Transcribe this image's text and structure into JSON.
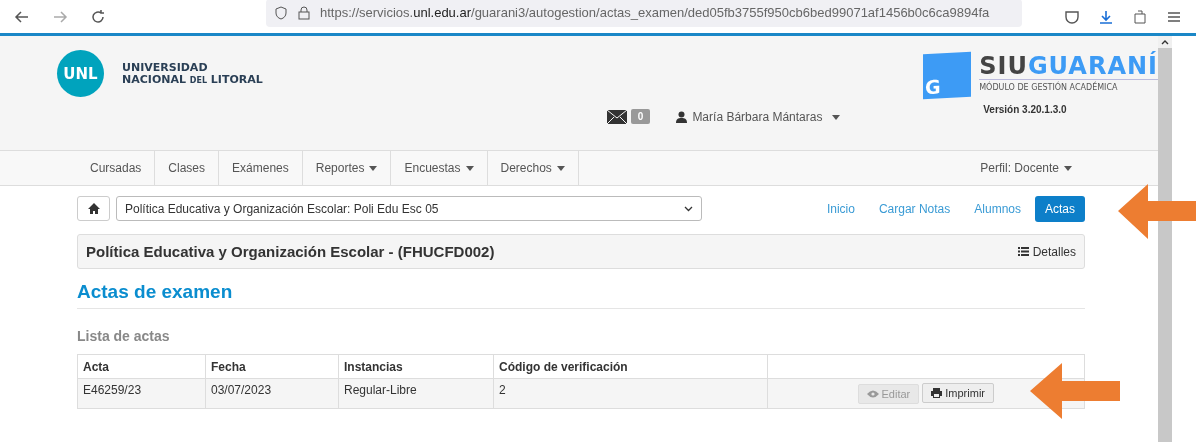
{
  "browser": {
    "url_host_before": "https://servicios.",
    "url_host": "unl.edu.ar",
    "url_path": "/guarani3/autogestion/actas_examen/ded05fb3755f950cb6bed99071af1456b0c6ca9894fa"
  },
  "header": {
    "unl_logo": {
      "mark": "UNL",
      "line1": "UNIVERSIDAD",
      "line2_start": "NACIONAL",
      "line2_small": "DEL",
      "line2_end": "LITORAL"
    },
    "messages_count": "0",
    "user": "María Bárbara Mántaras",
    "siu_logo": {
      "mark": "G",
      "siu": "SIU",
      "guarani": "GUARANÍ",
      "subtitle": "MÓDULO DE GESTIÓN ACADÉMICA"
    },
    "version": "Versión 3.20.1.3.0"
  },
  "nav": {
    "items": [
      {
        "label": "Cursadas",
        "dropdown": false
      },
      {
        "label": "Clases",
        "dropdown": false
      },
      {
        "label": "Exámenes",
        "dropdown": false
      },
      {
        "label": "Reportes",
        "dropdown": true
      },
      {
        "label": "Encuestas",
        "dropdown": true
      },
      {
        "label": "Derechos",
        "dropdown": true
      }
    ],
    "profile": "Perfil: Docente"
  },
  "course_select": {
    "value": "Política Educativa y Organización Escolar: Poli Edu Esc 05"
  },
  "subnav": [
    {
      "label": "Inicio",
      "selected": false
    },
    {
      "label": "Cargar Notas",
      "selected": false
    },
    {
      "label": "Alumnos",
      "selected": false
    },
    {
      "label": "Actas",
      "selected": true
    }
  ],
  "panel": {
    "title": "Política Educativa y Organización Escolar - (FHUCFD002)",
    "details": "Detalles"
  },
  "heading": "Actas de examen",
  "subheading": "Lista de actas",
  "table": {
    "columns": [
      "Acta",
      "Fecha",
      "Instancias",
      "Código de verificación"
    ],
    "rows": [
      {
        "cells": [
          "E46259/23",
          "03/07/2023",
          "Regular-Libre",
          "2"
        ],
        "actions": [
          {
            "label": "Editar",
            "kind": "view",
            "disabled": true
          },
          {
            "label": "Imprimir",
            "kind": "print",
            "disabled": false
          }
        ]
      }
    ]
  }
}
